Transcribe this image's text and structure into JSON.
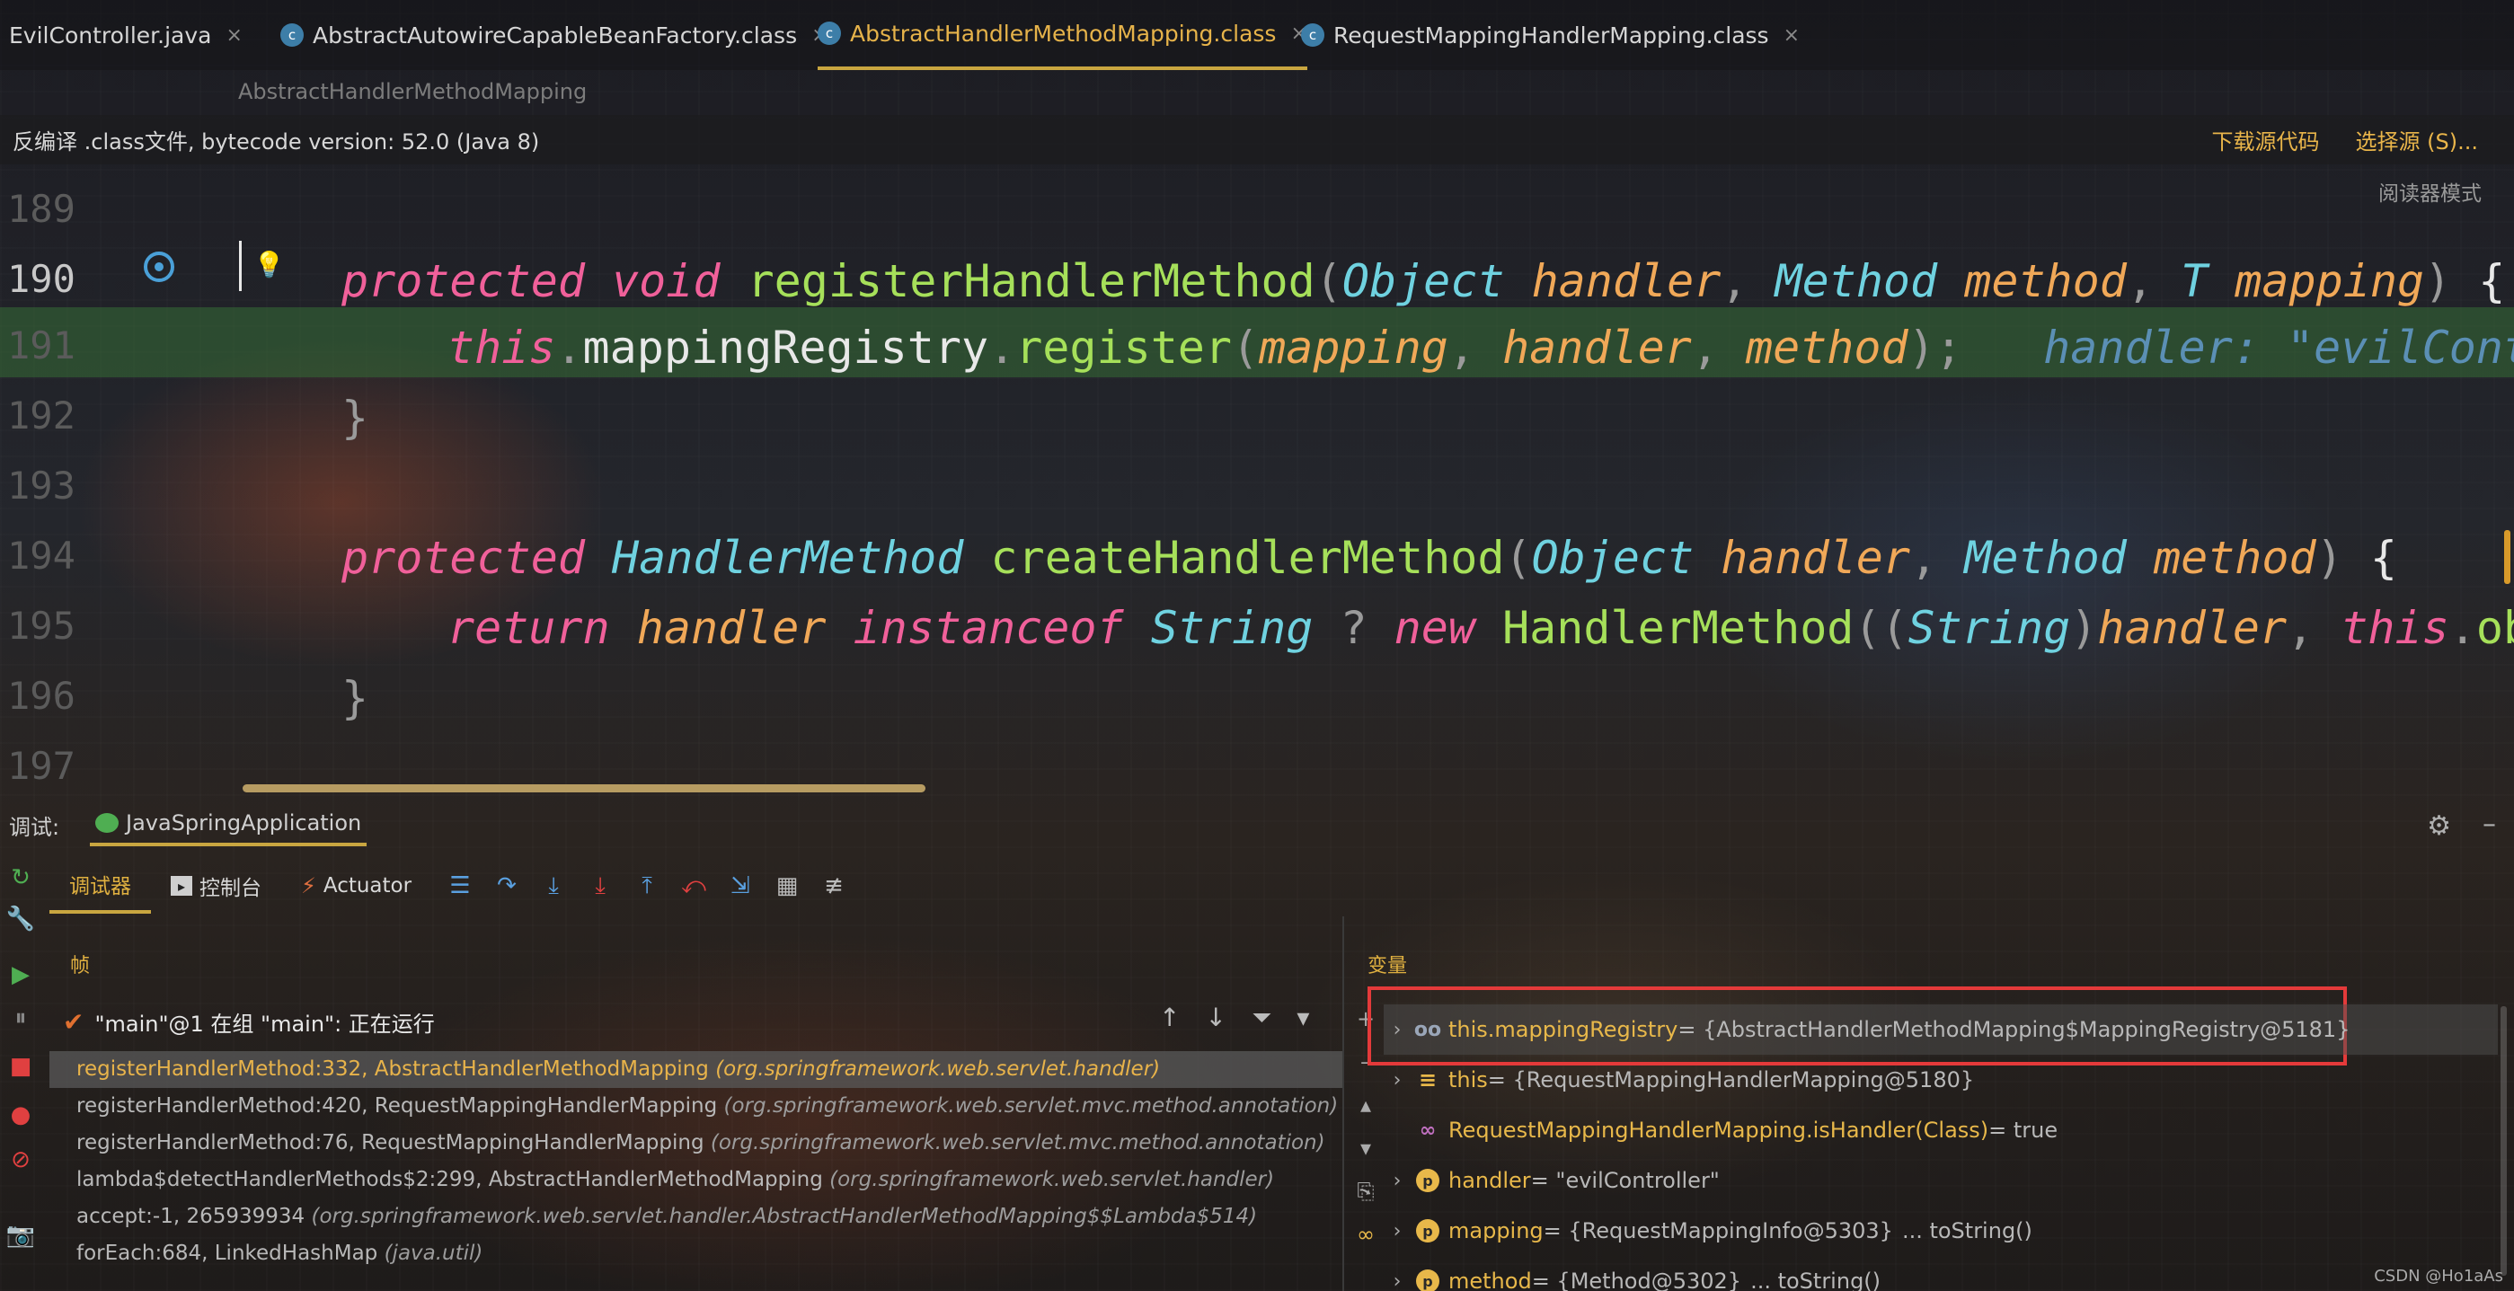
{
  "tabs": [
    {
      "label": "EvilController.java",
      "icon": "java-class-icon",
      "active": false
    },
    {
      "label": "AbstractAutowireCapableBeanFactory.class",
      "icon": "class-file-icon",
      "active": false
    },
    {
      "label": "AbstractHandlerMethodMapping.class",
      "icon": "class-file-icon",
      "active": true
    },
    {
      "label": "RequestMappingHandlerMapping.class",
      "icon": "class-file-icon",
      "active": false
    }
  ],
  "breadcrumb": "AbstractHandlerMethodMapping",
  "banner": {
    "text": "反编译 .class文件, bytecode version: 52.0 (Java 8)",
    "download_source": "下载源代码",
    "choose_source": "选择源 (S)..."
  },
  "reader_mode": "阅读器模式",
  "editor": {
    "line_numbers": [
      "189",
      "190",
      "191",
      "192",
      "193",
      "194",
      "195",
      "196",
      "197"
    ],
    "current_line": "190"
  },
  "debug": {
    "label": "调试:",
    "run_config": "JavaSpringApplication",
    "tabs": {
      "debugger": "调试器",
      "console": "控制台",
      "actuator": "Actuator"
    },
    "frames_title": "帧",
    "variables_title": "变量",
    "thread": "\"main\"@1 在组 \"main\": 正在运行",
    "frames": [
      {
        "method": "registerHandlerMethod:332, AbstractHandlerMethodMapping",
        "pkg": "(org.springframework.web.servlet.handler)",
        "selected": true
      },
      {
        "method": "registerHandlerMethod:420, RequestMappingHandlerMapping",
        "pkg": "(org.springframework.web.servlet.mvc.method.annotation)",
        "selected": false
      },
      {
        "method": "registerHandlerMethod:76, RequestMappingHandlerMapping",
        "pkg": "(org.springframework.web.servlet.mvc.method.annotation)",
        "selected": false
      },
      {
        "method": "lambda$detectHandlerMethods$2:299, AbstractHandlerMethodMapping",
        "pkg": "(org.springframework.web.servlet.handler)",
        "selected": false
      },
      {
        "method": "accept:-1, 265939934",
        "pkg": "(org.springframework.web.servlet.handler.AbstractHandlerMethodMapping$$Lambda$514)",
        "selected": false
      },
      {
        "method": "forEach:684, LinkedHashMap",
        "pkg": "(java.util)",
        "selected": false
      }
    ],
    "variables": [
      {
        "icon": "watch-icon",
        "name": "this.mappingRegistry",
        "value": " = {AbstractHandlerMethodMapping$MappingRegistry@5181}",
        "tail": ""
      },
      {
        "icon": "fields-icon",
        "name": "this",
        "value": " = {RequestMappingHandlerMapping@5180}",
        "tail": ""
      },
      {
        "icon": "method-return-icon",
        "name": "RequestMappingHandlerMapping.isHandler(Class)",
        "value": " = true",
        "tail": ""
      },
      {
        "icon": "param-icon",
        "name": "handler",
        "value": " = \"evilController\"",
        "tail": ""
      },
      {
        "icon": "param-icon",
        "name": "mapping",
        "value": " = {RequestMappingInfo@5303}",
        "tail": "... toString()"
      },
      {
        "icon": "param-icon",
        "name": "method",
        "value": " = {Method@5302}",
        "tail": "... toString()"
      }
    ]
  },
  "watermark": "CSDN @Ho1aAs",
  "colors": {
    "accent": "#c9a640",
    "keyword": "#f0609a",
    "type": "#6fd2e0",
    "param": "#f0a858",
    "function": "#a6e05a",
    "highlight_box": "#e43a3a"
  }
}
